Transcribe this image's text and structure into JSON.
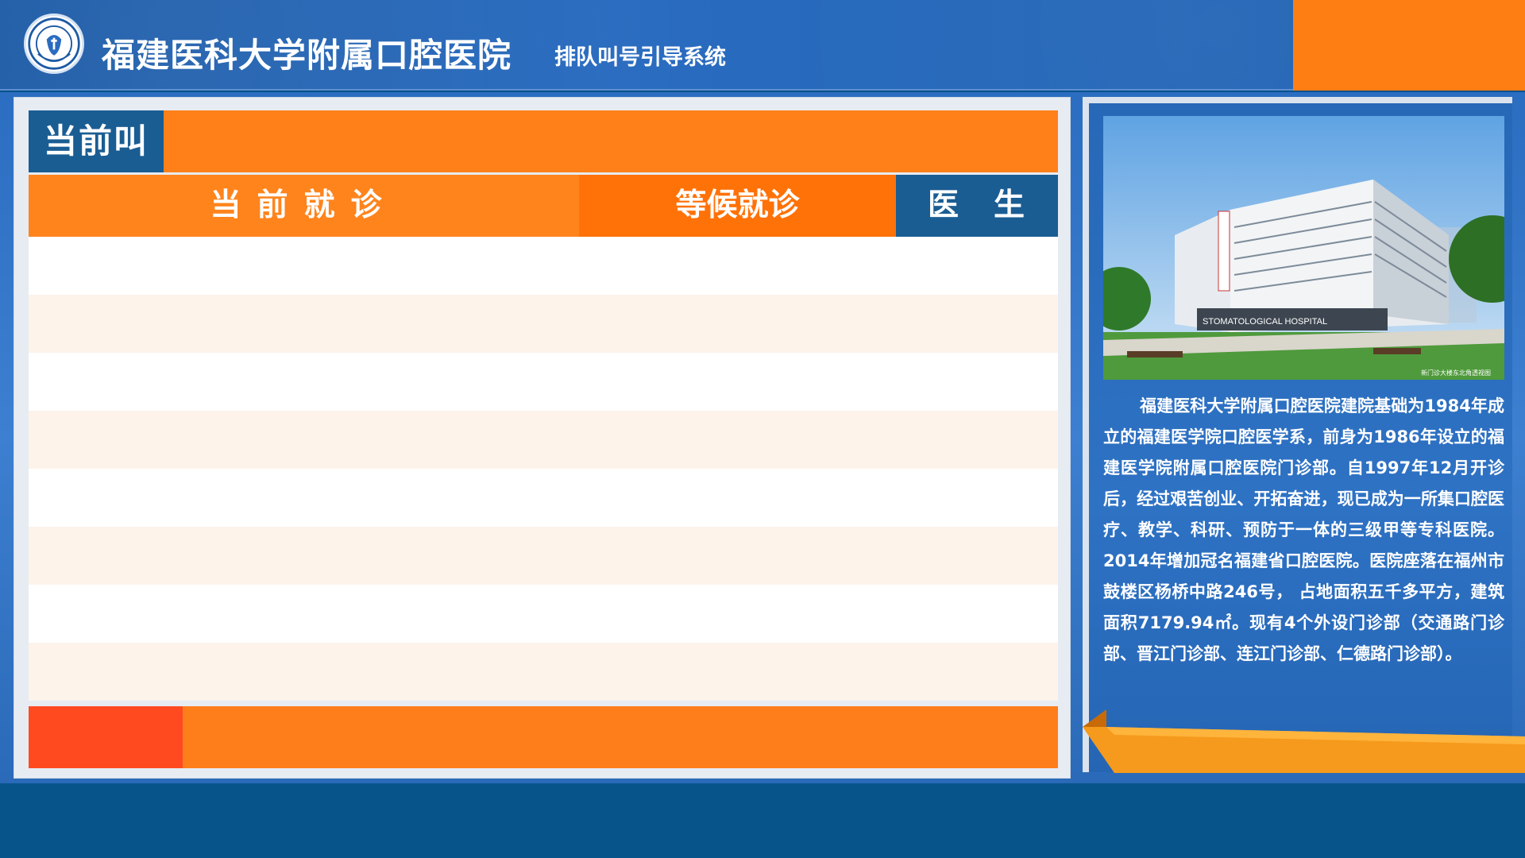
{
  "header": {
    "hospital_name": "福建医科大学附属口腔医院",
    "system_name": "排队叫号引导系统",
    "logo_icon": "hospital-logo-icon"
  },
  "call_panel": {
    "title": "当前叫号",
    "columns": {
      "current": "当前就诊",
      "waiting": "等候就诊",
      "doctor": "医生"
    },
    "rows": [
      "",
      "",
      "",
      "",
      "",
      "",
      "",
      ""
    ]
  },
  "info_panel": {
    "photo_icon": "hospital-building-photo",
    "photo_sign": "STOMATOLOGICAL HOSPITAL",
    "photo_caption": "新门诊大楼东北角透视图",
    "description": "福建医科大学附属口腔医院建院基础为1984年成立的福建医学院口腔医学系，前身为1986年设立的福建医学院附属口腔医院门诊部。自1997年12月开诊后，经过艰苦创业、开拓奋进，现已成为一所集口腔医疗、教学、科研、预防于一体的三级甲等专科医院。2014年增加冠名福建省口腔医院。医院座落在福州市鼓楼区杨桥中路246号， 占地面积五千多平方，建筑面积7179.94㎡。现有4个外设门诊部（交通路门诊部、晋江门诊部、连江门诊部、仁德路门诊部）。"
  },
  "colors": {
    "orange": "#ff8019",
    "dark_blue": "#1a5d93",
    "red": "#ff4a20",
    "header_blue": "#2a6cc0"
  }
}
